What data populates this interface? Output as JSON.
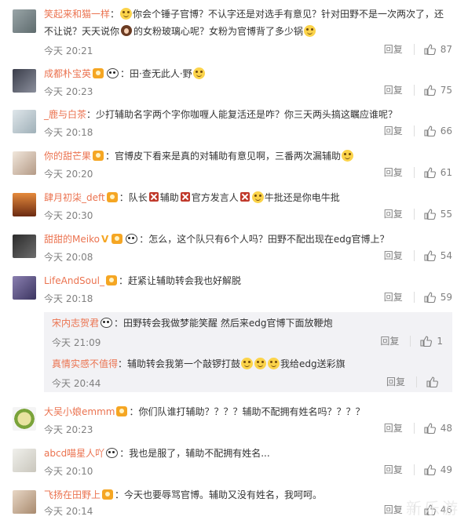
{
  "comments": [
    {
      "user": "笑起来和猫一样",
      "sep": "：",
      "text_parts": [
        "你会个锤子官博？不认字还是对选手有意见？针对田野不是一次两次了，还",
        "不让说？天天说你",
        "的女粉玻璃心呢？女粉为官博背了多少锅"
      ],
      "time": "今天 20:21",
      "reply": "回复",
      "likes": "87"
    },
    {
      "user": "成都朴宝英",
      "sep": "：田·查无此人·野",
      "time": "今天 20:23",
      "reply": "回复",
      "likes": "75"
    },
    {
      "user": "_鹿与白茶",
      "sep": "：少打辅助名字两个字你咖喱人能复活还是咋？你三天两头搞这瞩应谁呢？",
      "time": "今天 20:18",
      "reply": "回复",
      "likes": "66"
    },
    {
      "user": "你的甜芒果",
      "sep": "：官博皮下看来是真的对辅助有意见啊，三番两次漏辅助",
      "time": "今天 20:20",
      "reply": "回复",
      "likes": "61"
    },
    {
      "user": "肆月初柒_deft",
      "text_parts": [
        "：队长",
        "辅助",
        "官方发言人",
        "",
        "牛批还是你电牛批"
      ],
      "time": "今天 20:30",
      "reply": "回复",
      "likes": "55"
    },
    {
      "user": "甜甜的Meiko",
      "sep": "：怎么，这个队只有6个人吗？田野不配出现在edg官博上？",
      "time": "今天 20:08",
      "reply": "回复",
      "likes": "54"
    },
    {
      "user": "LifeAndSoul_",
      "sep": "：赶紧让辅助转会我也好解脱",
      "time": "今天 20:18",
      "reply": "回复",
      "likes": "59"
    },
    {
      "user": "大吴小娘emmm",
      "sep": "：你们队谁打辅助？？？？辅助不配拥有姓名吗？？？？",
      "time": "今天 20:23",
      "reply": "回复",
      "likes": "48"
    },
    {
      "user": "abcd喵星人吖",
      "sep": "：我也是服了，辅助不配拥有姓名...",
      "time": "今天 20:10",
      "reply": "回复",
      "likes": "49"
    },
    {
      "user": "飞扬在田野上",
      "sep": "：今天也要辱骂官博。辅助又没有姓名，我呵呵。",
      "time": "今天 20:14",
      "reply": "回复",
      "likes": "46"
    }
  ],
  "sub_replies": [
    {
      "user": "宋内志贺君",
      "sep": "：田野转会我做梦能笑醒 然后来edg官博下面放鞭炮",
      "time": "今天 21:09",
      "reply": "回复",
      "likes": "1"
    },
    {
      "user": "真情实感不值得",
      "text_parts": [
        "：辅助转会我第一个敲锣打鼓",
        "我给edg送彩旗"
      ],
      "time": "今天 20:44",
      "reply": "回复",
      "likes": ""
    }
  ],
  "watermark": "新乐游",
  "colors": {
    "username": "#eb7350",
    "meta": "#808080",
    "sub_bg": "#f2f2f5"
  }
}
